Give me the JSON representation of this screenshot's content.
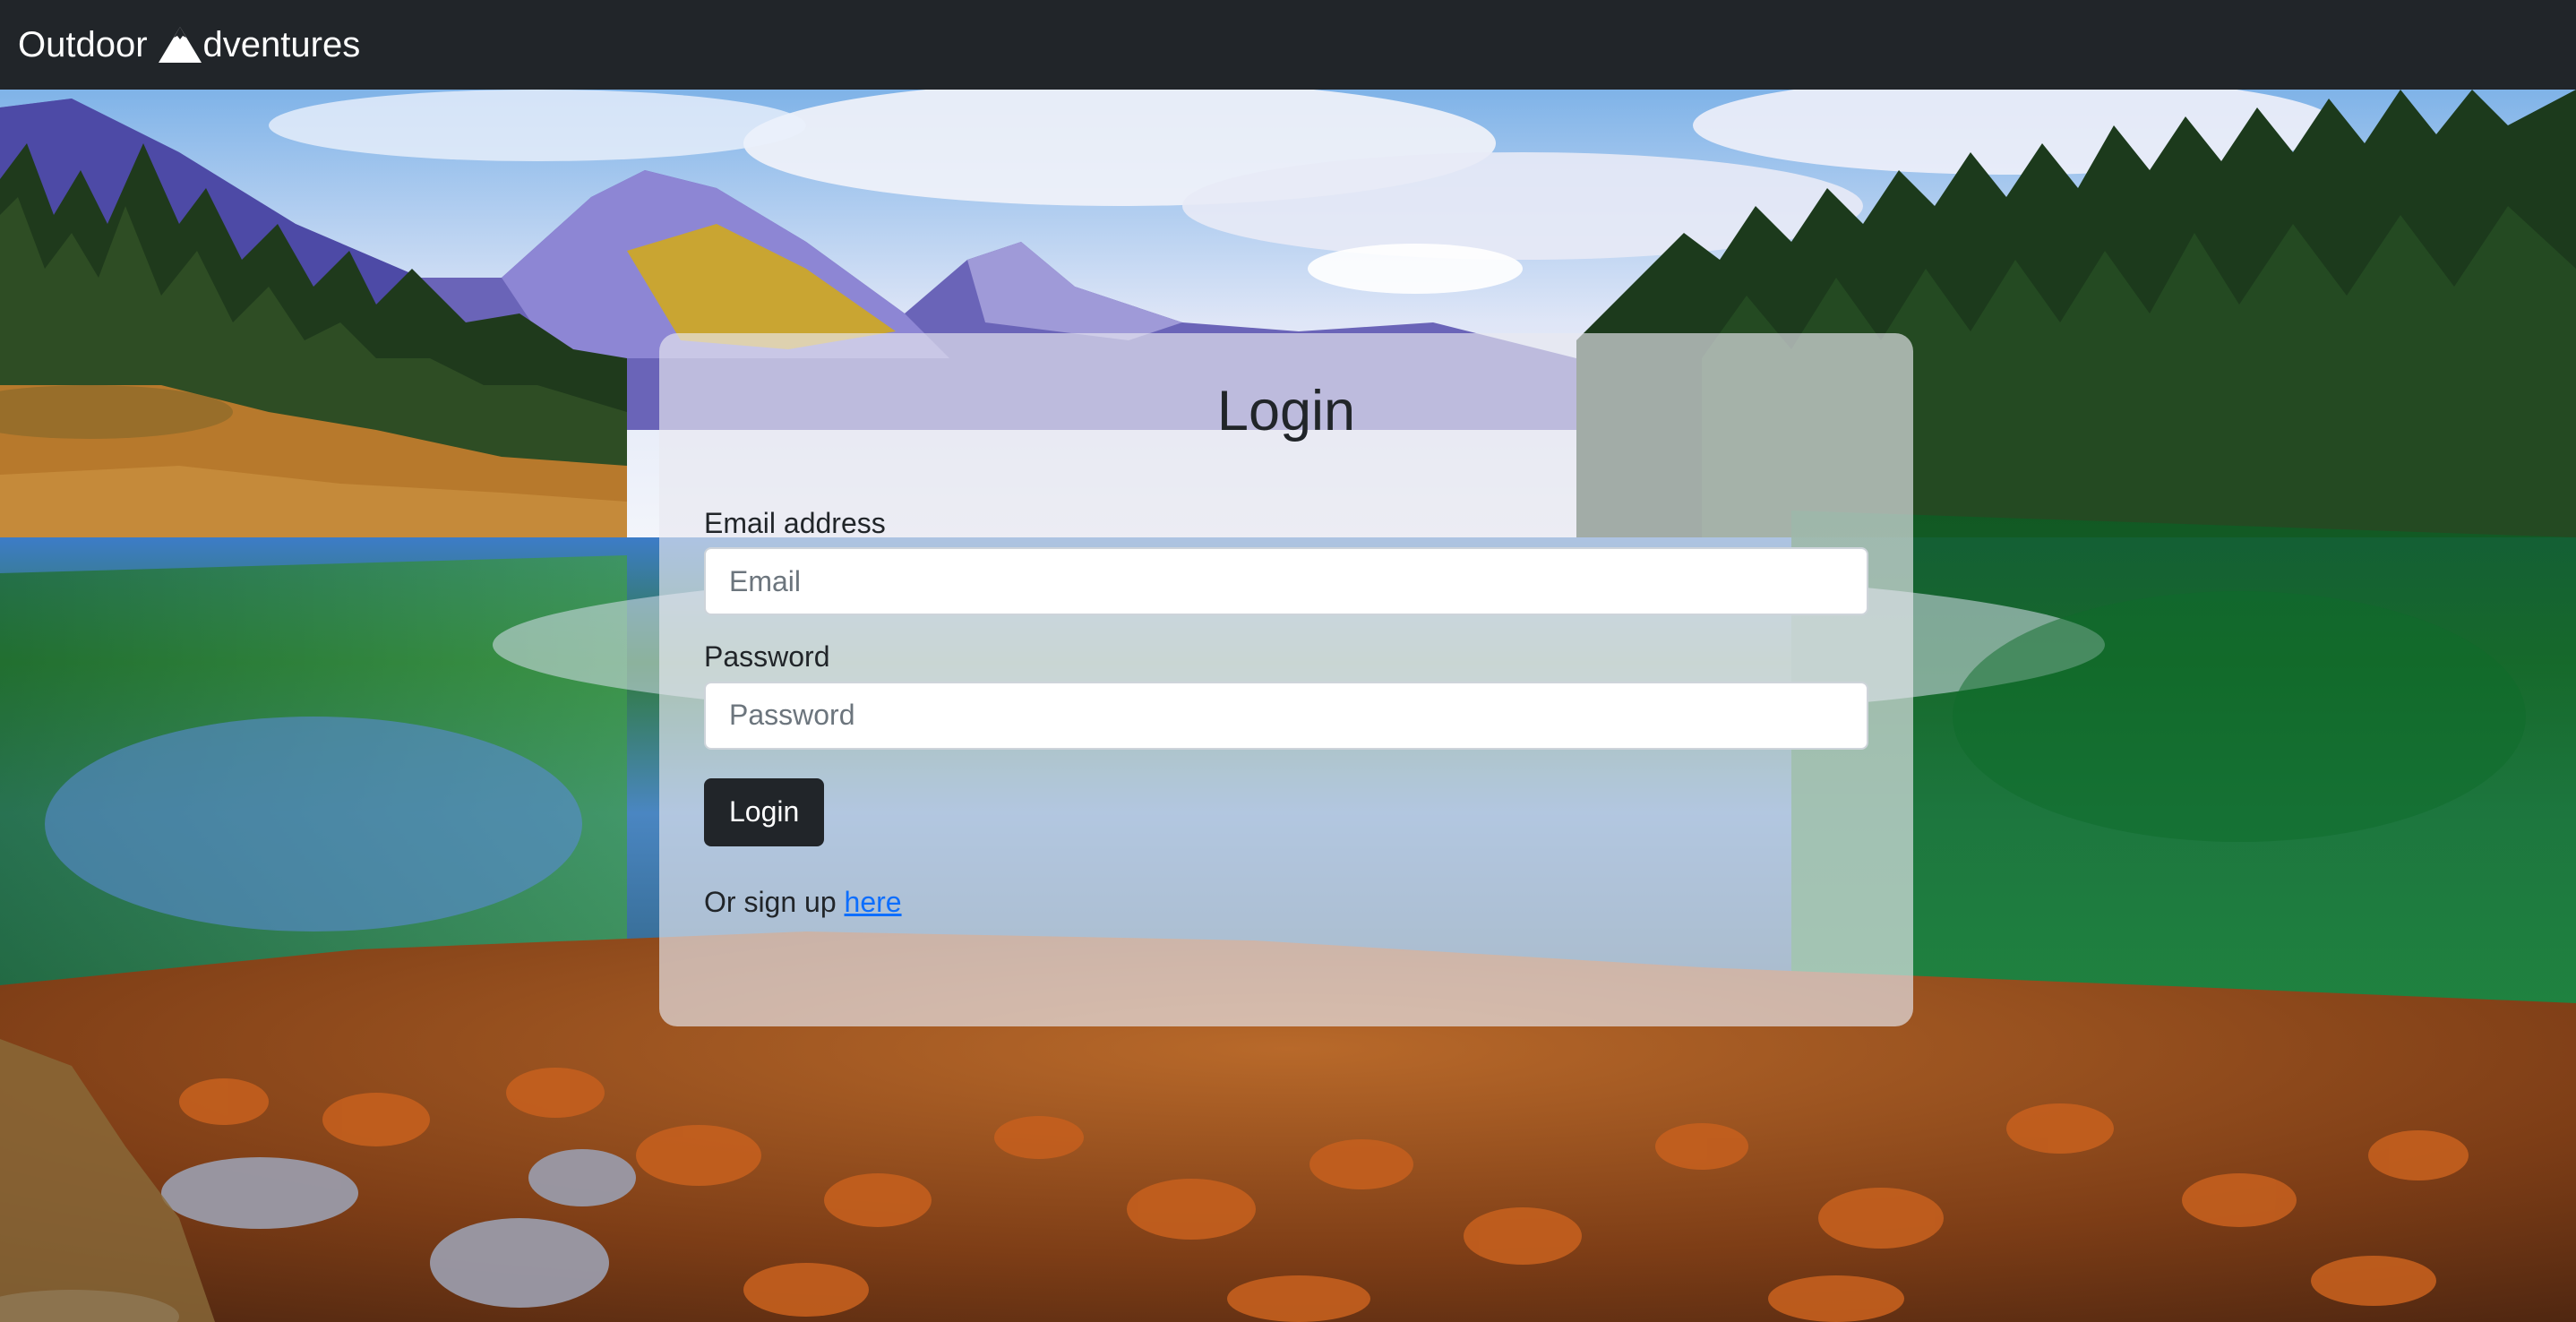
{
  "navbar": {
    "brand_before": "Outdoor ",
    "brand_after": "dventures",
    "brand_icon": "mountain-icon",
    "background_color": "#212529"
  },
  "background": {
    "image": "mountain-lake-landscape"
  },
  "login": {
    "title": "Login",
    "email_label": "Email address",
    "email_placeholder": "Email",
    "email_value": "",
    "password_label": "Password",
    "password_placeholder": "Password",
    "password_value": "",
    "submit_label": "Login",
    "signup_text": "Or sign up ",
    "signup_link_text": "here"
  },
  "colors": {
    "primary_dark": "#212529",
    "link": "#0d6efd",
    "card_background": "rgba(232,232,240,0.66)"
  }
}
